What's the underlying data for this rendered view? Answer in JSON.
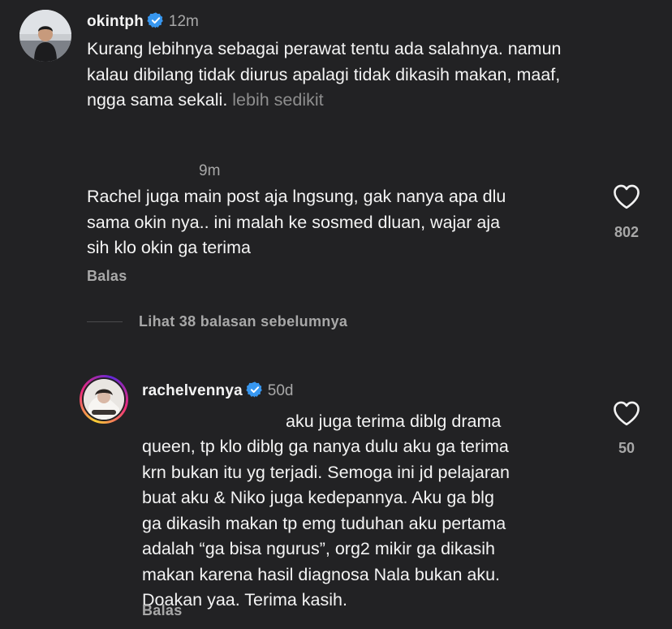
{
  "comment1": {
    "username": "okintph",
    "time": "12m",
    "text": "Kurang lebihnya sebagai perawat tentu ada salahnya. namun\nkalau dibilang tidak diurus apalagi tidak dikasih makan, maaf,\nngga sama sekali.",
    "more_label": "lebih sedikit"
  },
  "comment2": {
    "time": "9m",
    "text": "Rachel juga main post aja lngsung, gak nanya apa dlu\nsama okin nya.. ini malah ke sosmed dluan, wajar aja\nsih klo okin ga terima",
    "like_count": "802",
    "reply_label": "Balas"
  },
  "view_replies": {
    "label": "Lihat 38 balasan sebelumnya"
  },
  "comment3": {
    "username": "rachelvennya",
    "time": "50d",
    "text_first_line": "aku juga terima diblg drama",
    "text": "queen, tp klo diblg ga nanya dulu aku ga terima\nkrn bukan itu yg terjadi. Semoga ini jd pelajaran\nbuat aku & Niko juga kedepannya. Aku ga blg\nga dikasih makan tp emg tuduhan aku pertama\nadalah “ga bisa ngurus”, org2 mikir ga dikasih\nmakan karena hasil diagnosa Nala bukan aku.\nDoakan yaa. Terima kasih.",
    "like_count": "50",
    "reply_label": "Balas"
  },
  "colors": {
    "background": "#222224",
    "verified": "#3797f0",
    "muted": "#a8a8a8"
  },
  "icons": [
    "verified-badge-icon",
    "heart-outline-icon"
  ]
}
